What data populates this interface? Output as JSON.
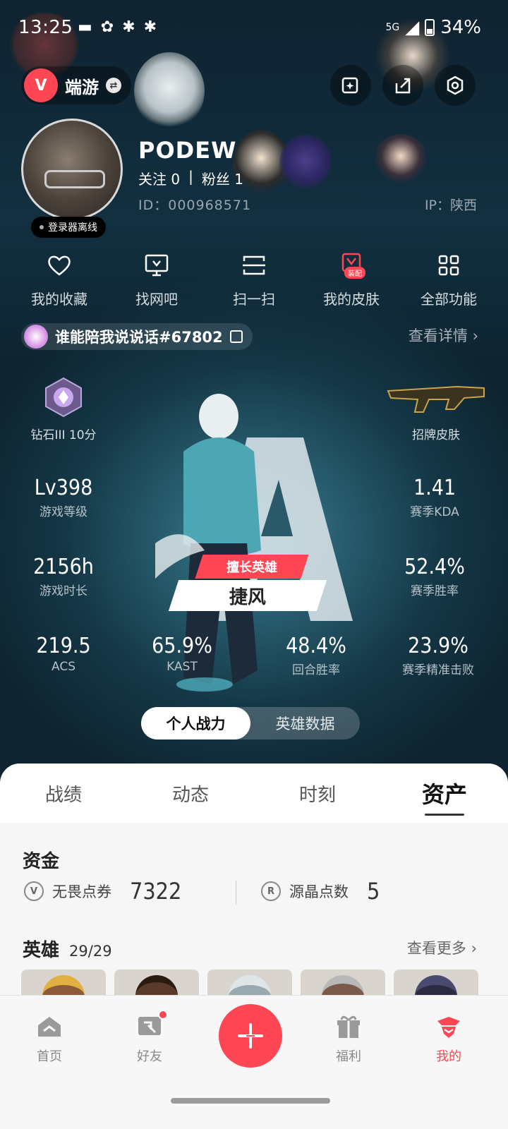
{
  "status_bar": {
    "time": "13:25",
    "network": "5G",
    "battery": "34%"
  },
  "header": {
    "game_name": "端游",
    "game_logo": "V"
  },
  "profile": {
    "username": "PODEW",
    "following_label": "关注",
    "following_count": "0",
    "separator": "|",
    "followers_label": "粉丝",
    "followers_count": "1",
    "id_text": "ID：000968571",
    "ip_text": "IP：陕西",
    "status_text": "登录器离线"
  },
  "actions": [
    {
      "label": "我的收藏",
      "icon": "heart-icon"
    },
    {
      "label": "找网吧",
      "icon": "monitor-icon"
    },
    {
      "label": "扫一扫",
      "icon": "scan-icon"
    },
    {
      "label": "我的皮肤",
      "icon": "skin-icon",
      "badge": "装配"
    },
    {
      "label": "全部功能",
      "icon": "grid-icon"
    }
  ],
  "title_strip": {
    "text": "谁能陪我说说话#67802",
    "view_detail": "查看详情 ›"
  },
  "stats": {
    "rank_label": "钻石III 10分",
    "signature_skin_label": "招牌皮肤",
    "level_value": "Lv398",
    "level_label": "游戏等级",
    "kda_value": "1.41",
    "kda_label": "赛季KDA",
    "hours_value": "2156h",
    "hours_label": "游戏时长",
    "winrate_value": "52.4%",
    "winrate_label": "赛季胜率",
    "acs_value": "219.5",
    "acs_label": "ACS",
    "kast_value": "65.9%",
    "kast_label": "KAST",
    "round_value": "48.4%",
    "round_label": "回合胜率",
    "precision_value": "23.9%",
    "precision_label": "赛季精准击败"
  },
  "hero_tag": {
    "top": "擅长英雄",
    "name": "捷风"
  },
  "segment": {
    "options": [
      "个人战力",
      "英雄数据"
    ],
    "selected": "个人战力"
  },
  "tabs": {
    "items": [
      "战绩",
      "动态",
      "时刻",
      "资产"
    ],
    "active": "资产"
  },
  "assets": {
    "funds_title": "资金",
    "vp_label": "无畏点券",
    "vp_value": "7322",
    "rp_label": "源晶点数",
    "rp_value": "5",
    "heroes_title": "英雄",
    "heroes_owned": "29",
    "heroes_total": "29",
    "heroes_sep": "/",
    "see_more": "查看更多 ›"
  },
  "bottom_nav": {
    "items": [
      {
        "label": "首页",
        "icon": "home-icon"
      },
      {
        "label": "好友",
        "icon": "friends-icon"
      },
      {
        "label": "",
        "icon": "plus-icon"
      },
      {
        "label": "福利",
        "icon": "gift-icon"
      },
      {
        "label": "我的",
        "icon": "profile-icon"
      }
    ],
    "active": "我的"
  },
  "colors": {
    "accent": "#ff4655",
    "background": "#0f1923",
    "sheet": "#f6f6f6"
  }
}
